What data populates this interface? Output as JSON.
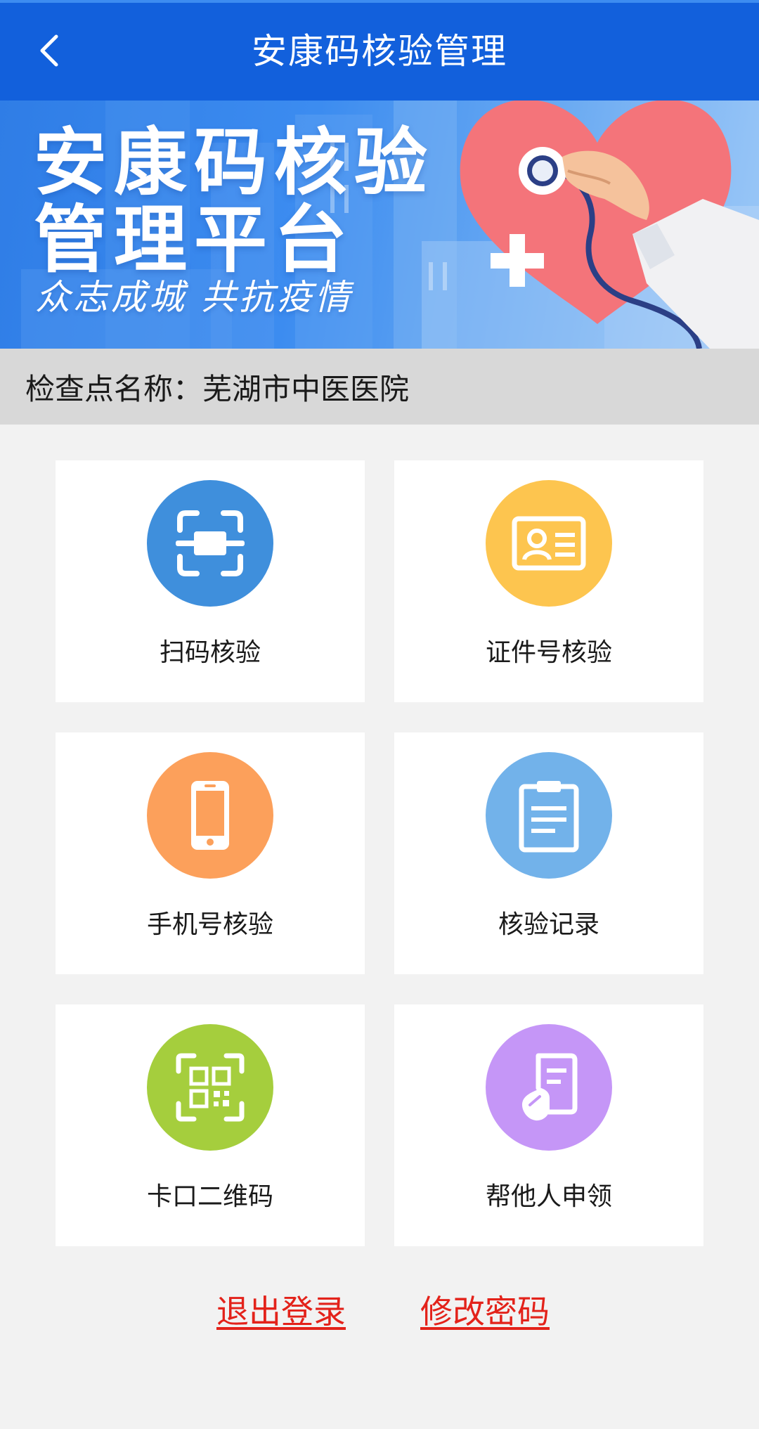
{
  "header": {
    "title": "安康码核验管理",
    "background": "#1260dc"
  },
  "banner": {
    "title_line1": "安康码核验",
    "title_line2": "管理平台",
    "slogan": "众志成城 共抗疫情"
  },
  "checkpoint": {
    "label": "检查点名称：",
    "value": "芜湖市中医医院"
  },
  "tiles": [
    {
      "label": "扫码核验",
      "icon": "scan-icon",
      "color": "#3f8fdc"
    },
    {
      "label": "证件号核验",
      "icon": "id-card-icon",
      "color": "#fdc54f"
    },
    {
      "label": "手机号核验",
      "icon": "phone-icon",
      "color": "#fca05b"
    },
    {
      "label": "核验记录",
      "icon": "clipboard-icon",
      "color": "#72b2ea"
    },
    {
      "label": "卡口二维码",
      "icon": "qr-code-icon",
      "color": "#a5ce3d"
    },
    {
      "label": "帮他人申领",
      "icon": "hand-document-icon",
      "color": "#c596f7"
    }
  ],
  "footer": {
    "logout_label": "退出登录",
    "change_password_label": "修改密码",
    "link_color": "#e3221a"
  }
}
